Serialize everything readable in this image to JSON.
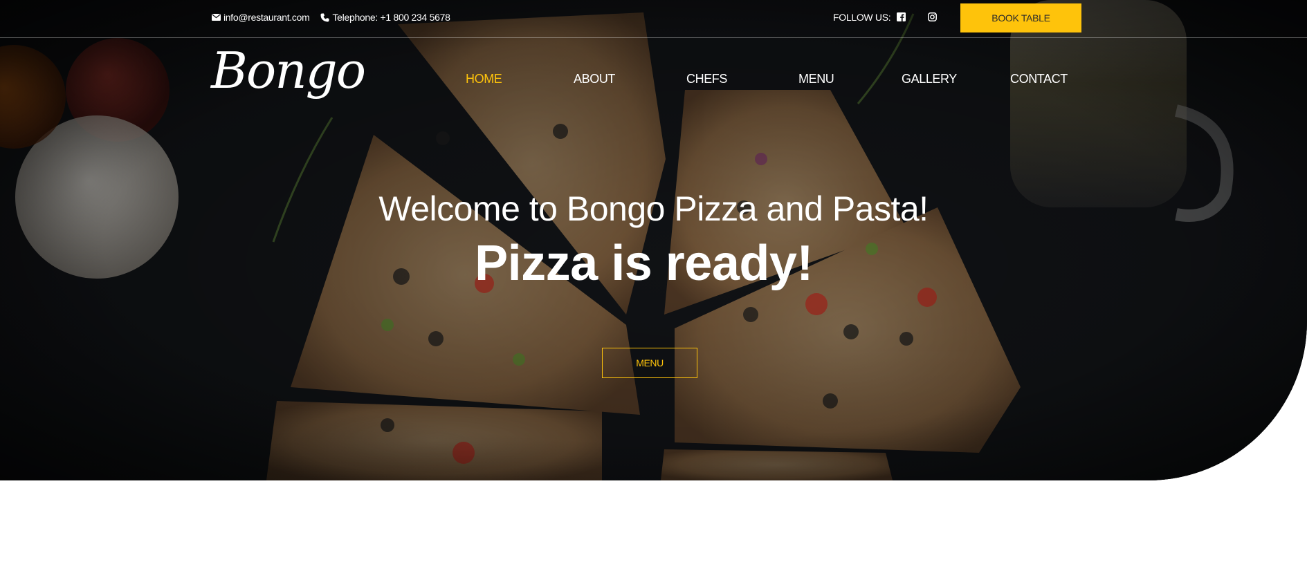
{
  "topbar": {
    "email": "info@restaurant.com",
    "phone": "Telephone: +1 800 234 5678",
    "follow_label": "FOLLOW US:",
    "book_button": "BOOK TABLE"
  },
  "brand": {
    "logo": "Bongo"
  },
  "nav": {
    "items": [
      {
        "label": "HOME",
        "active": true
      },
      {
        "label": "ABOUT"
      },
      {
        "label": "CHEFS"
      },
      {
        "label": "MENU"
      },
      {
        "label": "GALLERY"
      },
      {
        "label": "CONTACT"
      }
    ]
  },
  "hero": {
    "welcome": "Welcome to Bongo Pizza and Pasta!",
    "title_part": "Pizza is ",
    "title_bold": "ready!",
    "cta": "MENU"
  },
  "colors": {
    "accent": "#fec30b",
    "hero_bg": "#0b0c0e",
    "text": "#ffffff"
  },
  "icons": {
    "email": "envelope-icon",
    "phone": "phone-icon",
    "facebook": "facebook-icon",
    "instagram": "instagram-icon"
  }
}
